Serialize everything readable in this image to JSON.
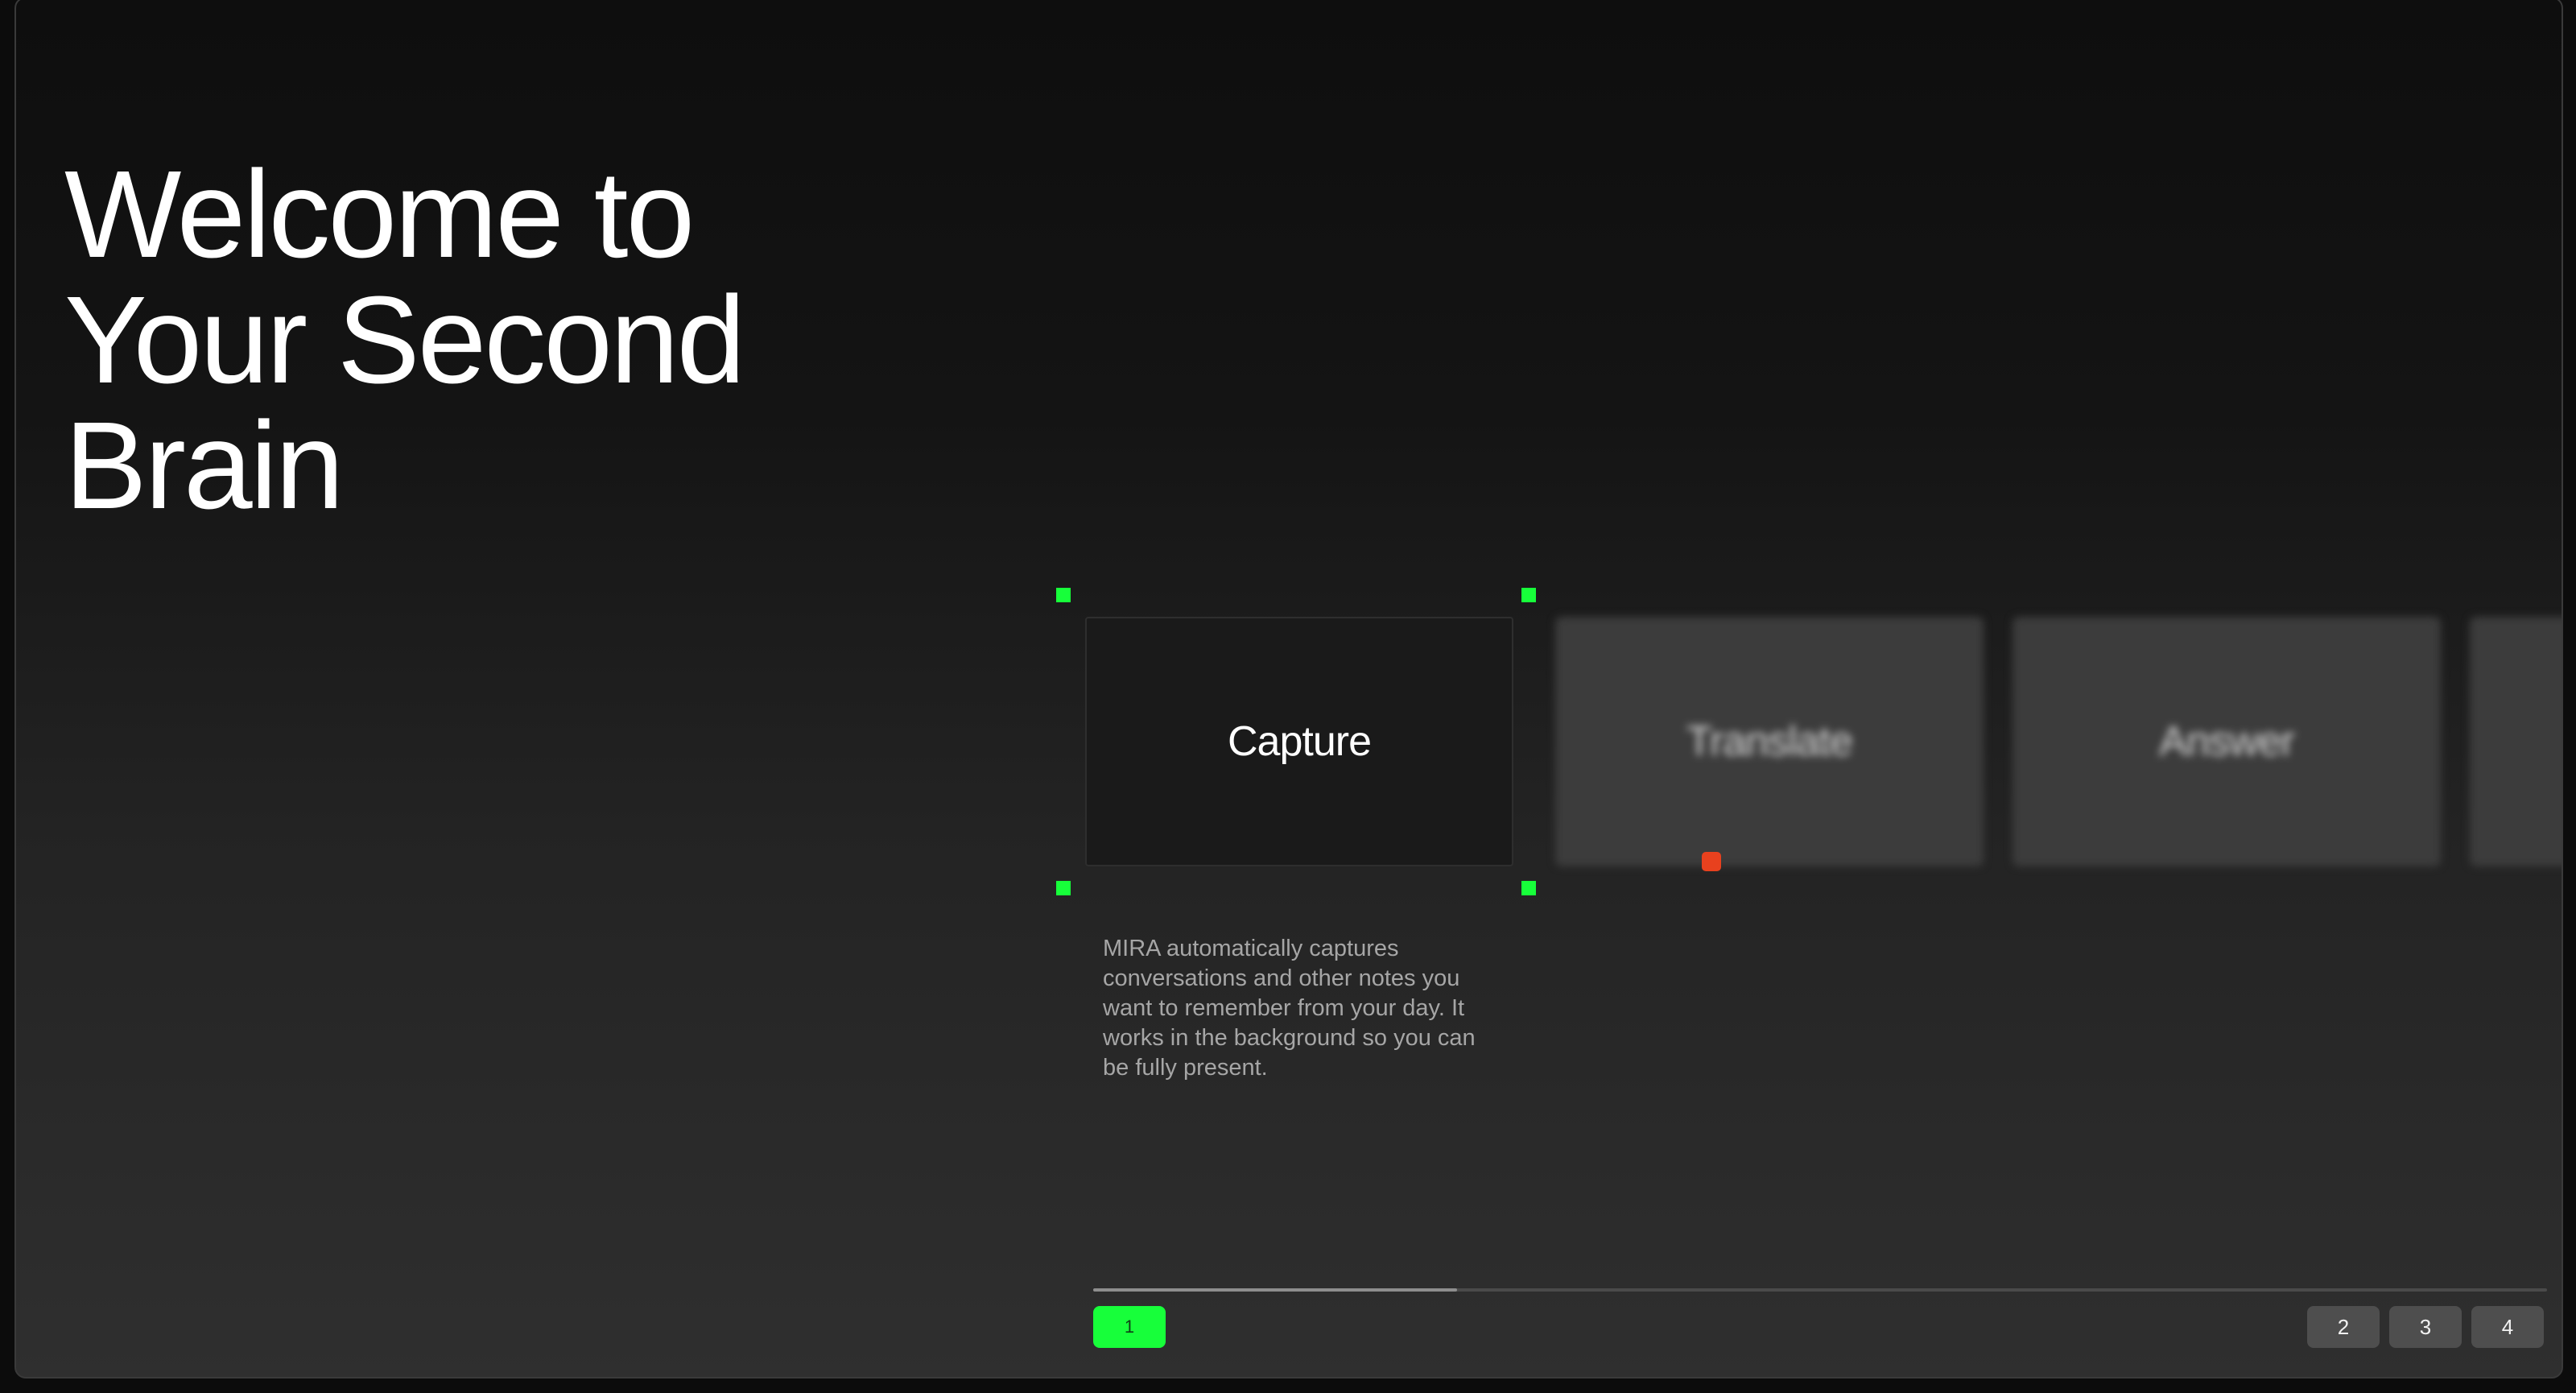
{
  "hero": {
    "title_lines": [
      "Welcome to",
      "Your Second",
      "Brain"
    ]
  },
  "carousel": {
    "cards": [
      {
        "label": "Capture",
        "active": true
      },
      {
        "label": "Translate",
        "active": false
      },
      {
        "label": "Answer",
        "active": false
      },
      {
        "label": "",
        "active": false
      }
    ],
    "description": "MIRA automatically captures conversations and other notes you want to remember from your day. It works in the background so you can be fully present."
  },
  "progress": {
    "value": 0.25
  },
  "pagination": {
    "pages": [
      "1",
      "2",
      "3",
      "4"
    ],
    "current": "1"
  },
  "colors": {
    "accent": "#17ff3a",
    "cursor": "#e8411e",
    "background": "#0c0c0c"
  }
}
